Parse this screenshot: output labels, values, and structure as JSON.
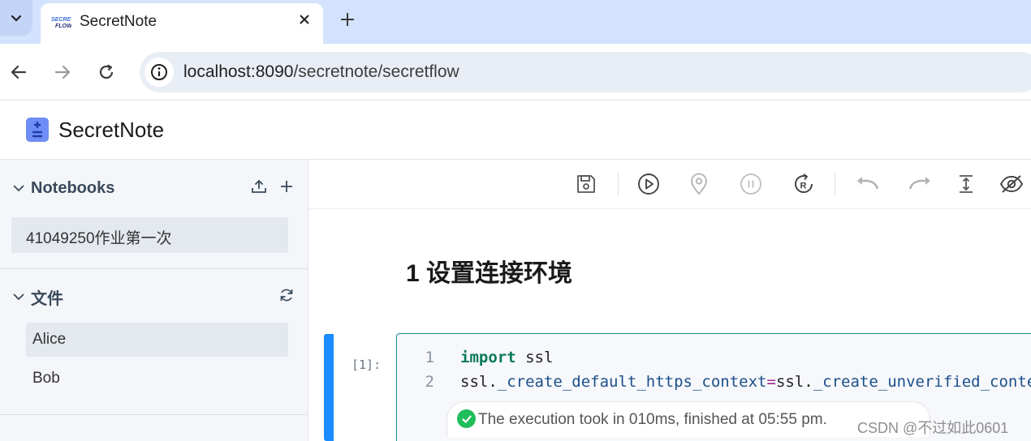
{
  "browser": {
    "tab_title": "SecretNote",
    "url_host": "localhost:8090",
    "url_path": "/secretnote/secretflow",
    "favicon_text": "SECRET FLOW"
  },
  "app": {
    "title": "SecretNote"
  },
  "sidebar": {
    "notebooks": {
      "title": "Notebooks",
      "items": [
        "41049250作业第一次"
      ]
    },
    "files": {
      "title": "文件",
      "items": [
        "Alice",
        "Bob"
      ],
      "active": "Alice"
    }
  },
  "toolbar": {
    "buttons": [
      "save",
      "run",
      "locate",
      "pause",
      "restart",
      "undo",
      "redo",
      "move",
      "hide"
    ]
  },
  "notebook": {
    "heading": "1 设置连接环境",
    "cell": {
      "prompt": "[1]:",
      "lines": [
        {
          "num": "1",
          "kw": "import",
          "rest": " ssl"
        },
        {
          "num": "2",
          "a": "ssl.",
          "b": "_create_default_https_context",
          "op": "=",
          "c": "ssl.",
          "d": "_create_unverified_context"
        }
      ],
      "execution": "The execution took in 010ms, finished at 05:55 pm."
    }
  },
  "watermark": "CSDN @不过如此0601",
  "colors": {
    "tabstrip": "#d3e3fd",
    "cell_active": "#1a8cff",
    "success": "#1fbe5a",
    "keyword": "#0b7a55"
  }
}
